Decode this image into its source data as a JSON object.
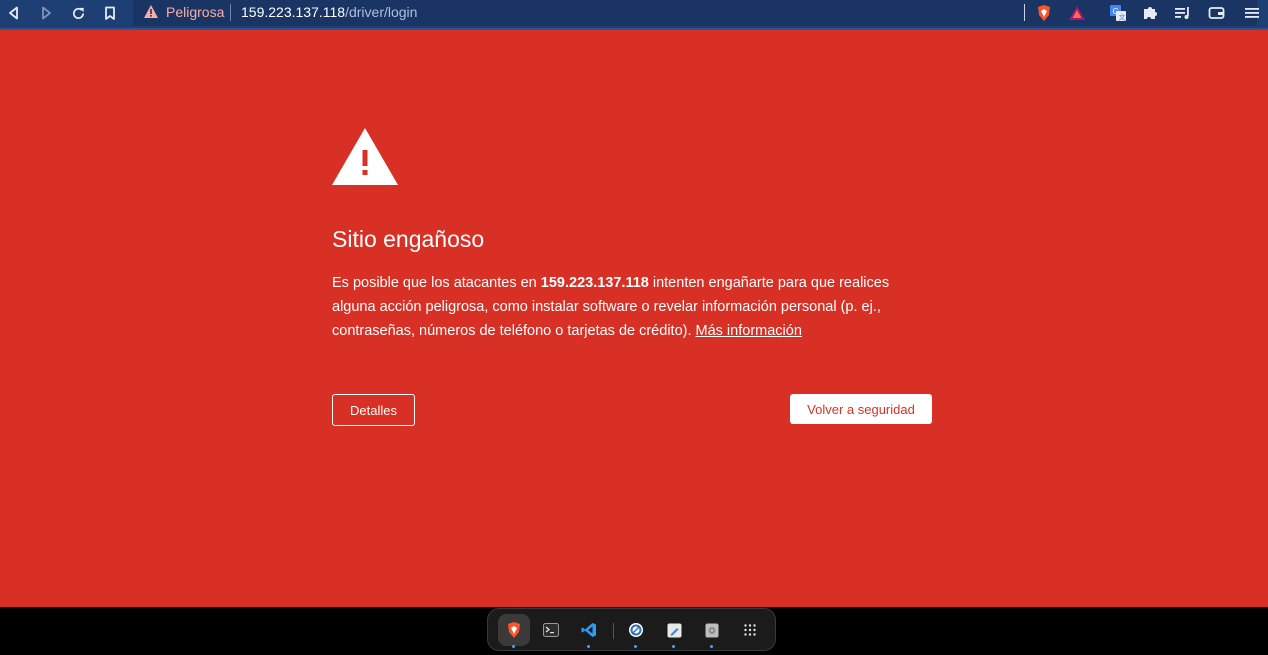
{
  "browser": {
    "security_status": "Peligrosa",
    "url_host": "159.223.137.118",
    "url_path": "/driver/login",
    "nav_icons": [
      "back-icon",
      "forward-icon",
      "reload-icon",
      "bookmark-icon"
    ],
    "extension_icons": [
      "brave-shields-icon",
      "brave-rewards-icon",
      "translate-icon",
      "extensions-icon",
      "playlist-icon",
      "wallet-icon",
      "menu-icon"
    ]
  },
  "interstitial": {
    "heading": "Sitio engañoso",
    "message_prefix": "Es posible que los atacantes en ",
    "message_host": "159.223.137.118",
    "message_suffix": " intenten engañarte para que realices alguna acción peligrosa, como instalar software o revelar información personal (p. ej., contraseñas, números de teléfono o tarjetas de crédito). ",
    "learn_more": "Más información",
    "details_button": "Detalles",
    "back_button": "Volver a seguridad",
    "background_color": "#d93025"
  },
  "dock": {
    "items": [
      "brave-browser-icon",
      "terminal-icon",
      "vscode-icon",
      "app-icon",
      "text-editor-icon",
      "disk-icon",
      "app-grid-icon"
    ]
  }
}
